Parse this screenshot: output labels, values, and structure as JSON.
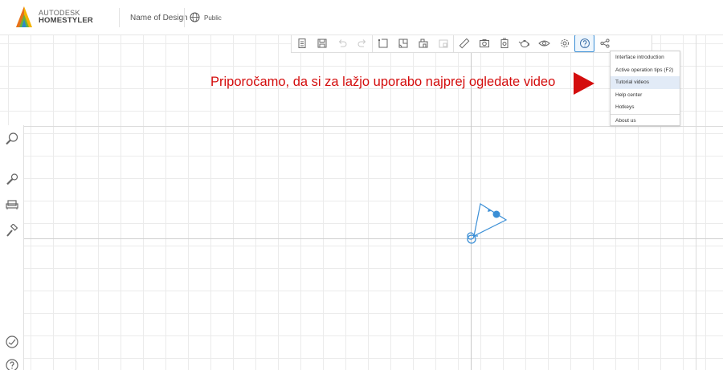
{
  "brand": {
    "line1": "AUTODESK",
    "line2": "HOMESTYLER"
  },
  "header": {
    "design_name": "Name of Design",
    "visibility": "Public"
  },
  "toolbar": {
    "buttons": [
      "new-file-icon",
      "save-icon",
      "undo-icon",
      "redo-icon",
      "draw-room-icon",
      "door-window-icon",
      "structure-icon",
      "wall-icon",
      "measure-icon",
      "snapshot-icon",
      "render-icon",
      "teapot-icon",
      "view-eye-icon",
      "settings-icon",
      "help-icon",
      "share-icon"
    ]
  },
  "help_menu": {
    "items": [
      "Interface introduction",
      "Active operation tips (F2)",
      "Tutorial videos",
      "Help center",
      "Hotkeys",
      "About us"
    ],
    "highlighted_index": 2
  },
  "annotation": {
    "text": "Priporočamo, da si za lažjo uporabo najprej ogledate video",
    "color": "#d40d0d"
  },
  "sidebar": {
    "icons": [
      "search-icon",
      "brush-icon",
      "sofa-icon",
      "paint-roller-icon",
      "compass-icon",
      "help-icon"
    ]
  },
  "colors": {
    "accent": "#3b8fd6",
    "annotation": "#d40d0d"
  }
}
